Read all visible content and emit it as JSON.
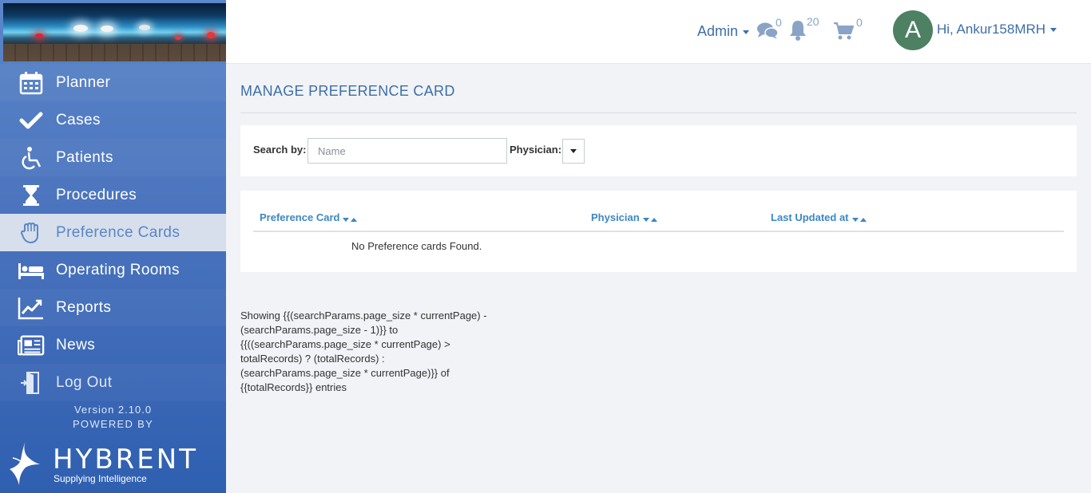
{
  "header": {
    "admin_label": "Admin",
    "messages_count": "0",
    "notifications_count": "20",
    "cart_count": "0",
    "avatar_initial": "A",
    "greeting": "Hi, Ankur158MRH"
  },
  "sidebar": {
    "items": [
      {
        "label": "Planner",
        "icon": "calendar-icon"
      },
      {
        "label": "Cases",
        "icon": "checkmark-icon"
      },
      {
        "label": "Patients",
        "icon": "wheelchair-icon"
      },
      {
        "label": "Procedures",
        "icon": "hourglass-icon"
      },
      {
        "label": "Preference Cards",
        "icon": "hand-icon"
      },
      {
        "label": "Operating Rooms",
        "icon": "bed-icon"
      },
      {
        "label": "Reports",
        "icon": "chart-line-icon"
      },
      {
        "label": "News",
        "icon": "newspaper-icon"
      },
      {
        "label": "Log Out",
        "icon": "door-exit-icon"
      }
    ],
    "active_item": "Preference Cards",
    "version": "Version 2.10.0",
    "powered_by": "POWERED BY",
    "brand_name": "HYBRENT",
    "brand_tagline": "Supplying Intelligence"
  },
  "main": {
    "title": "MANAGE PREFERENCE CARD",
    "search": {
      "label": "Search by:",
      "placeholder": "Name",
      "value": "",
      "physician_label": "Physician:",
      "physician_value": ""
    },
    "table": {
      "columns": [
        "Preference Card",
        "Physician",
        "Last Updated at"
      ],
      "empty_message": "No Preference cards Found."
    },
    "showing_text": "Showing {{(searchParams.page_size * currentPage) - (searchParams.page_size - 1)}} to {{((searchParams.page_size * currentPage) > totalRecords) ? (totalRecords) : (searchParams.page_size * currentPage)}} of {{totalRecords}} entries"
  },
  "colors": {
    "accent": "#3d6ea8",
    "sidebar_bg": "#4a73bd",
    "active_item_bg": "#d6dfeb",
    "avatar_bg": "#4e8064",
    "link_blue": "#3d86c6"
  }
}
